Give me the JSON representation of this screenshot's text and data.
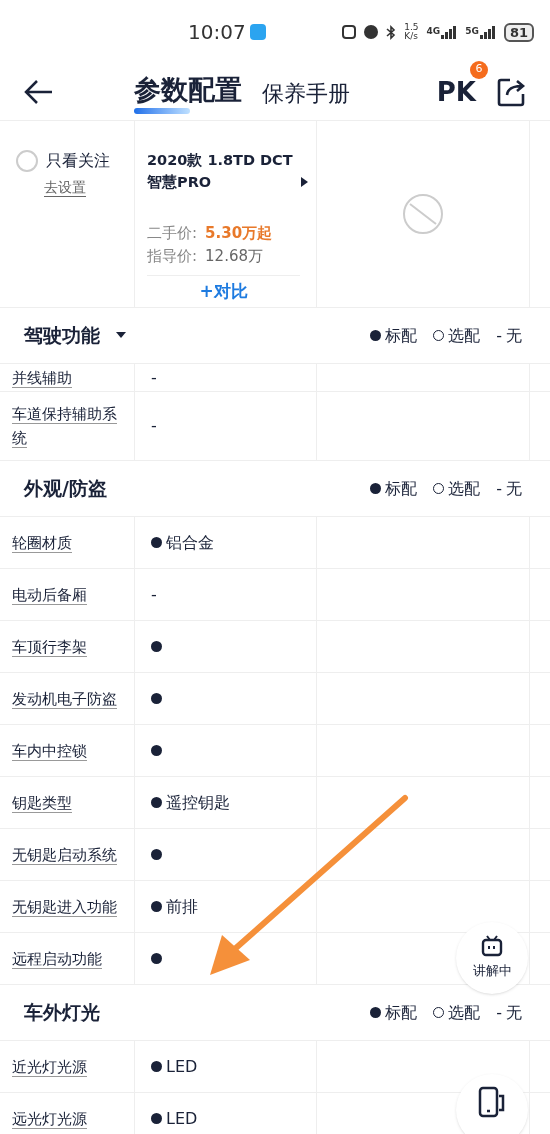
{
  "status_bar": {
    "time": "10:07",
    "net_speed": [
      "1.5",
      "K/s"
    ],
    "sig1": "4G",
    "sig2": "5G",
    "battery": "81"
  },
  "header": {
    "tabs": [
      {
        "label": "参数配置",
        "selected": true
      },
      {
        "label": "保养手册",
        "selected": false
      }
    ],
    "pk": {
      "label": "PK",
      "badge": "6"
    }
  },
  "car_header": {
    "follow": {
      "label": "只看关注",
      "checked": false,
      "link": "去设置"
    },
    "car": {
      "name": "2020款 1.8TD DCT 智慧PRO",
      "used_label": "二手价:",
      "used_price": "5.30万起",
      "guide_label": "指导价:",
      "guide_price": "12.68万",
      "compare": "+对比"
    }
  },
  "sections": [
    {
      "title": "驾驶功能",
      "dropdown": true,
      "legend": [
        {
          "kind": "filled",
          "label": "标配"
        },
        {
          "kind": "hollow",
          "label": "选配"
        },
        {
          "kind": "dash",
          "mark": "-",
          "label": "无"
        }
      ],
      "rows": [
        {
          "label": "并线辅助",
          "kind": "none",
          "value": "-",
          "partial": true
        },
        {
          "label": "车道保持辅助系统",
          "kind": "none",
          "value": "-"
        }
      ]
    },
    {
      "title": "外观/防盗",
      "dropdown": false,
      "legend": [
        {
          "kind": "filled",
          "label": "标配"
        },
        {
          "kind": "hollow",
          "label": "选配"
        },
        {
          "kind": "dash",
          "mark": "-",
          "label": "无"
        }
      ],
      "rows": [
        {
          "label": "轮圈材质",
          "kind": "standard",
          "value": "铝合金"
        },
        {
          "label": "电动后备厢",
          "kind": "none",
          "value": "-"
        },
        {
          "label": "车顶行李架",
          "kind": "standard"
        },
        {
          "label": "发动机电子防盗",
          "kind": "standard"
        },
        {
          "label": "车内中控锁",
          "kind": "standard"
        },
        {
          "label": "钥匙类型",
          "kind": "standard",
          "value": "遥控钥匙"
        },
        {
          "label": "无钥匙启动系统",
          "kind": "standard"
        },
        {
          "label": "无钥匙进入功能",
          "kind": "standard",
          "value": "前排"
        },
        {
          "label": "远程启动功能",
          "kind": "standard"
        }
      ]
    },
    {
      "title": "车外灯光",
      "dropdown": false,
      "legend": [
        {
          "kind": "filled",
          "label": "标配"
        },
        {
          "kind": "hollow",
          "label": "选配"
        },
        {
          "kind": "dash",
          "mark": "-",
          "label": "无"
        }
      ],
      "rows": [
        {
          "label": "近光灯光源",
          "kind": "standard",
          "value": "LED"
        },
        {
          "label": "远光灯光源",
          "kind": "standard",
          "value": "LED"
        }
      ]
    }
  ],
  "floating": {
    "explain": "讲解中"
  }
}
